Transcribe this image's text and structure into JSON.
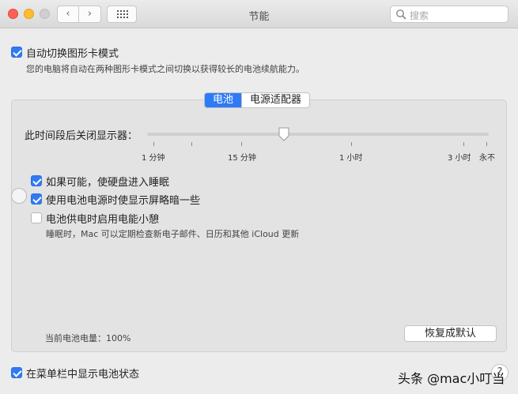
{
  "window": {
    "title": "节能"
  },
  "search": {
    "placeholder": "搜索"
  },
  "toolbar": {
    "back_glyph": "‹",
    "forward_glyph": "›"
  },
  "auto_switch": {
    "label": "自动切换图形卡模式",
    "checked": true,
    "description": "您的电脑将自动在两种图形卡模式之间切换以获得较长的电池续航能力。"
  },
  "tabs": [
    {
      "label": "电池",
      "active": true
    },
    {
      "label": "电源适配器",
      "active": false
    }
  ],
  "display_sleep": {
    "label": "此时间段后关闭显示器：",
    "ticks": [
      "1 分钟",
      "15 分钟",
      "1 小时",
      "3 小时",
      "永不"
    ],
    "value_fraction": 0.4
  },
  "options": [
    {
      "label": "如果可能，使硬盘进入睡眠",
      "checked": true
    },
    {
      "label": "使用电池电源时使显示屏略暗一些",
      "checked": true
    },
    {
      "label": "电池供电时启用电能小憩",
      "checked": false
    }
  ],
  "power_nap_note": "睡眠时，Mac 可以定期检查新电子邮件、日历和其他 iCloud 更新",
  "battery_level": "当前电池电量：100%",
  "restore_button": "恢复成默认",
  "show_in_menubar": {
    "label": "在菜单栏中显示电池状态",
    "checked": true
  },
  "help_glyph": "?",
  "watermark": "头条 @mac小叮当",
  "colors": {
    "accent": "#2f7bf5"
  }
}
